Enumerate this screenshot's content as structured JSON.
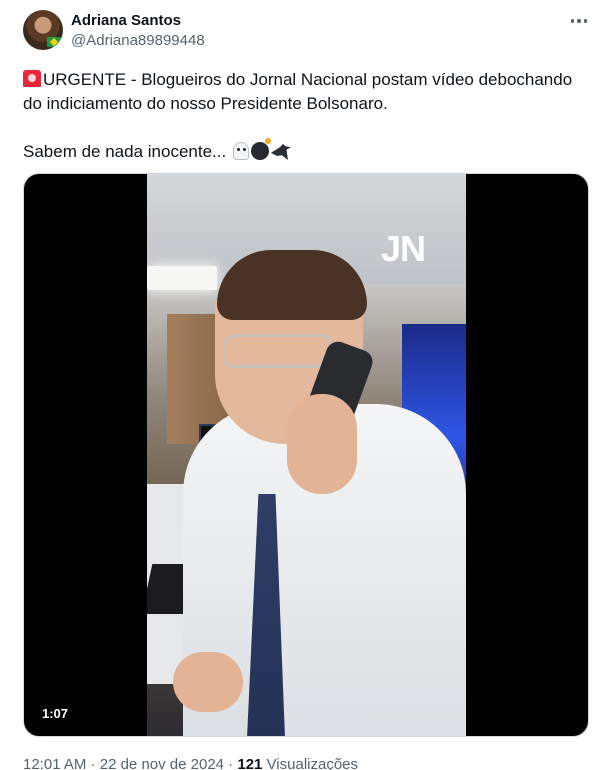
{
  "author": {
    "display_name": "Adriana Santos",
    "handle": "@Adriana89899448",
    "avatar_icon": "profile-photo-with-brazil-flag"
  },
  "menu": {
    "icon": "more-options-icon"
  },
  "tweet": {
    "line1": "URGENTE - Blogueiros do Jornal Nacional postam vídeo debochando",
    "line2": "do indiciamento do nosso Presidente Bolsonaro.",
    "line3": "Sabem de nada inocente...",
    "emojis": [
      "siren-emoji",
      "ghost-emoji",
      "bomb-emoji",
      "bird-emoji"
    ]
  },
  "media": {
    "watermark": "JN",
    "duration": "1:07"
  },
  "footer": {
    "time": "12:01 AM",
    "separator": " · ",
    "date": "22 de nov de 2024",
    "views_count": "121",
    "views_label": "Visualizações"
  }
}
